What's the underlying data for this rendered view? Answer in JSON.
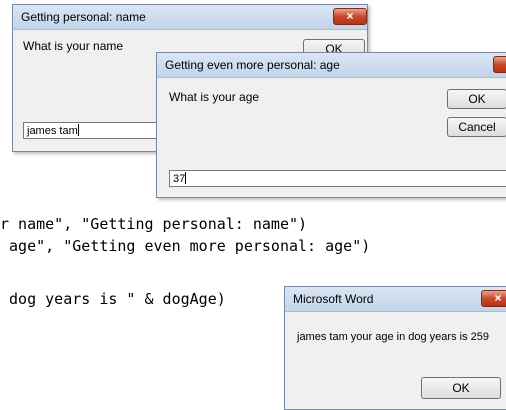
{
  "code_lines": [
    "r name\", \"Getting personal: name\")",
    " age\", \"Getting even more personal: age\")",
    " dog years is \" & dogAge)"
  ],
  "dialog_name": {
    "title": "Getting personal: name",
    "prompt": "What is your name",
    "ok_label": "OK",
    "close_label": "×",
    "input_value": "james tam"
  },
  "dialog_age": {
    "title": "Getting even more personal: age",
    "prompt": "What is your age",
    "ok_label": "OK",
    "cancel_label": "Cancel",
    "close_label": "×",
    "input_value": "37"
  },
  "msgbox": {
    "title": "Microsoft Word",
    "message": "james tam your age in dog years is 259",
    "ok_label": "OK",
    "close_label": "×"
  }
}
